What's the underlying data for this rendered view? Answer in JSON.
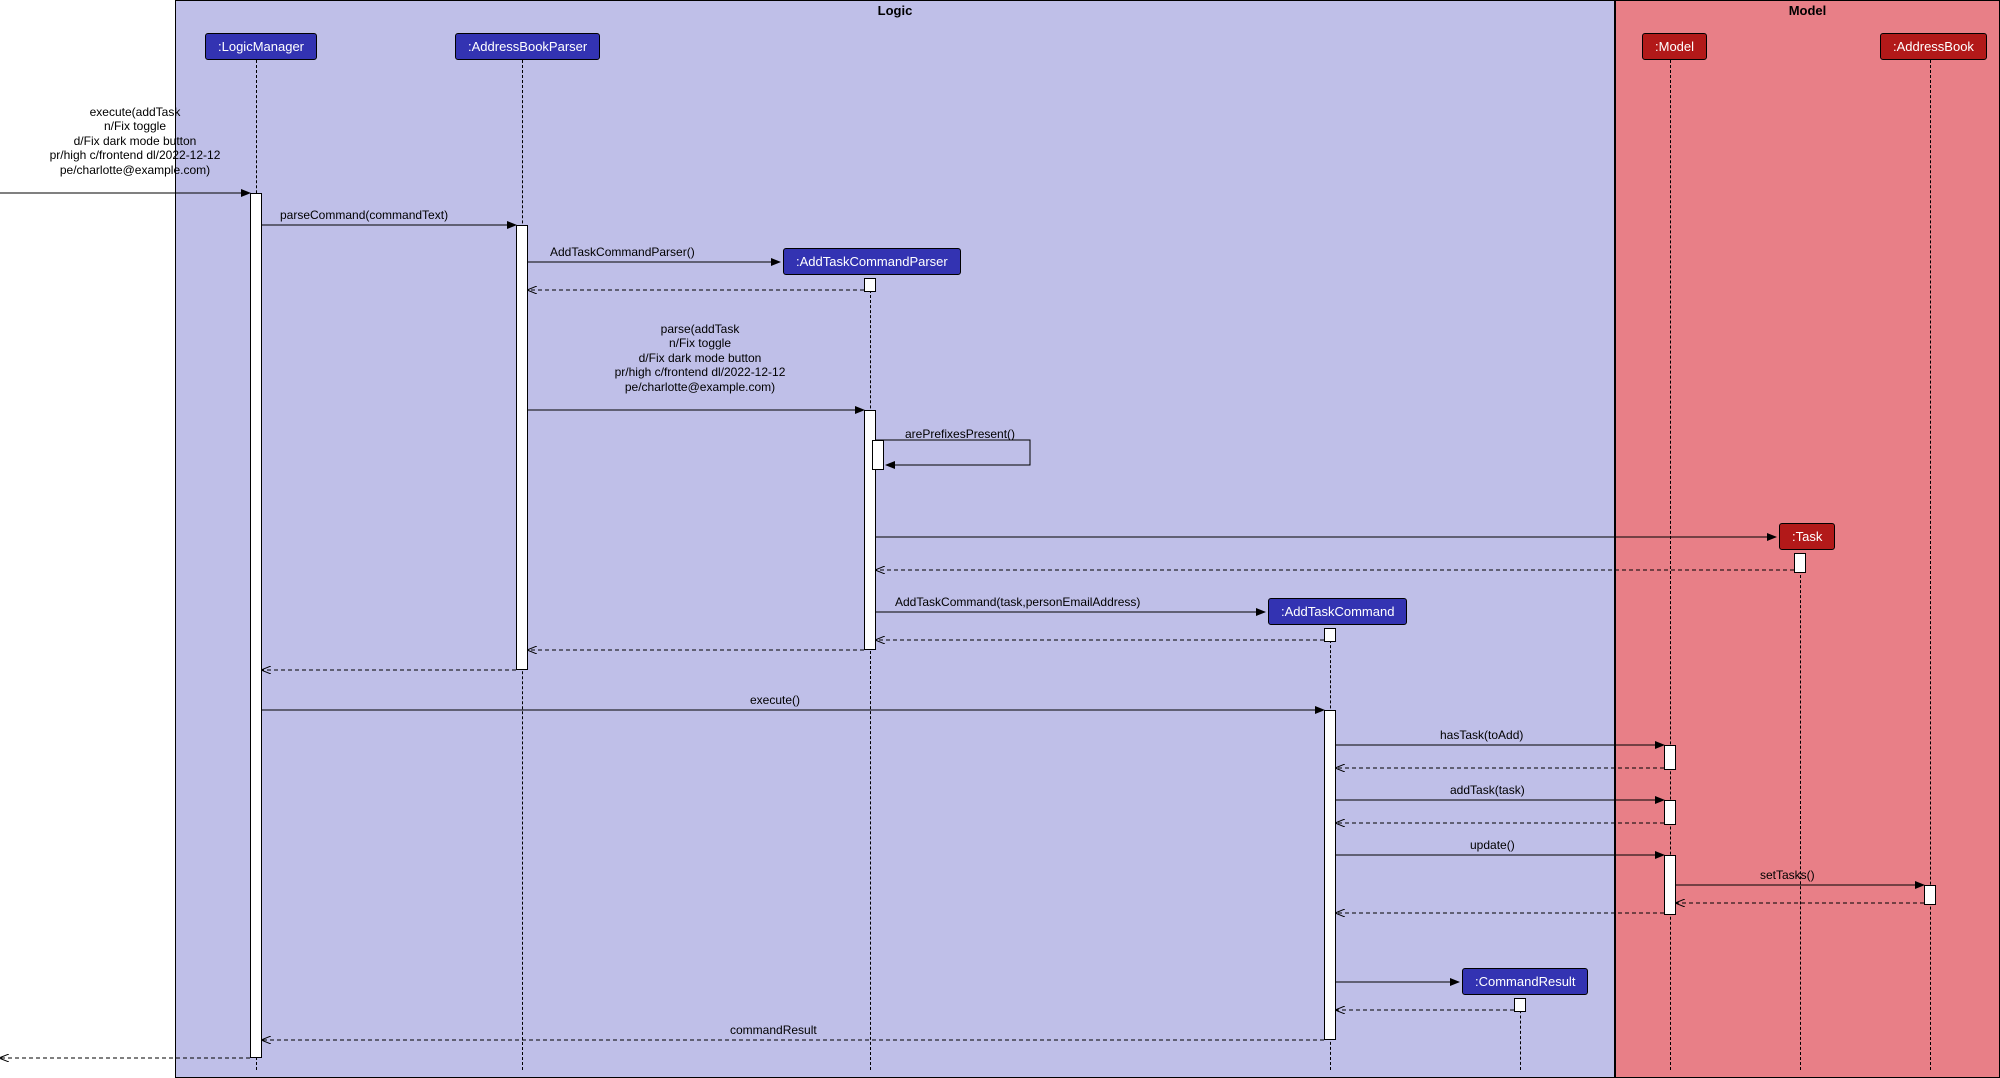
{
  "regions": {
    "logic_label": "Logic",
    "model_label": "Model"
  },
  "participants": {
    "logic_manager": ":LogicManager",
    "address_book_parser": ":AddressBookParser",
    "add_task_command_parser": ":AddTaskCommandParser",
    "add_task_command": ":AddTaskCommand",
    "command_result": ":CommandResult",
    "task": ":Task",
    "model": ":Model",
    "address_book": ":AddressBook"
  },
  "messages": {
    "execute_entry": "execute(addTask\nn/Fix toggle\nd/Fix dark mode button\npr/high c/frontend dl/2022-12-12\npe/charlotte@example.com)",
    "parse_command": "parseCommand(commandText)",
    "new_parser": "AddTaskCommandParser()",
    "parse_call": "parse(addTask\nn/Fix toggle\nd/Fix dark mode button\npr/high c/frontend dl/2022-12-12\npe/charlotte@example.com)",
    "are_prefixes": "arePrefixesPresent()",
    "add_task_cmd_new": "AddTaskCommand(task,personEmailAddress)",
    "execute_cmd": "execute()",
    "has_task": "hasTask(toAdd)",
    "add_task": "addTask(task)",
    "update": "update()",
    "set_tasks": "setTasks()",
    "command_result": "commandResult"
  }
}
